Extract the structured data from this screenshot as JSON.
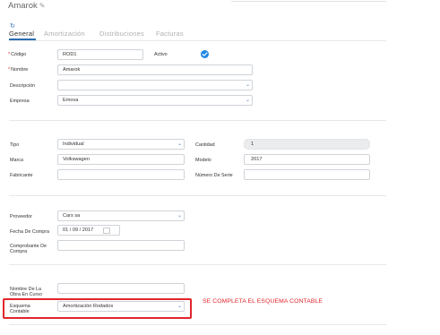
{
  "header": {
    "title": "Amarok"
  },
  "tabs": [
    {
      "label": "General",
      "active": true
    },
    {
      "label": "Amortización",
      "active": false
    },
    {
      "label": "Distribuciones",
      "active": false
    },
    {
      "label": "Facturas",
      "active": false
    }
  ],
  "fields": {
    "codigo": {
      "label": "Código",
      "value": "ROD1"
    },
    "activo": {
      "label": "Activo",
      "checked": true
    },
    "nombre": {
      "label": "Nombre",
      "value": "Amarok"
    },
    "descripcion": {
      "label": "Descripción",
      "value": ""
    },
    "empresa": {
      "label": "Empresa",
      "value": "Emova"
    },
    "tipo": {
      "label": "Tipo",
      "value": "Individual"
    },
    "cantidad": {
      "label": "Cantidad",
      "value": "1"
    },
    "marca": {
      "label": "Marca",
      "value": "Volkswagen"
    },
    "modelo": {
      "label": "Modelo",
      "value": "2017"
    },
    "fabricante": {
      "label": "Fabricante",
      "value": ""
    },
    "numero_serie": {
      "label": "Número De Serie",
      "value": ""
    },
    "proveedor": {
      "label": "Proveedor",
      "value": "Cars sa"
    },
    "fecha_compra": {
      "label": "Fecha De Compra",
      "value": "01 / 09 / 2017"
    },
    "comprobante": {
      "label_1": "Comprobante De",
      "label_2": "Compra",
      "value": ""
    },
    "nombre_obra": {
      "label_1": "Nombre De La",
      "label_2": "Obra En Curso",
      "value": ""
    },
    "esquema": {
      "label_1": "Esquema",
      "label_2": "Contable",
      "value": "Amortización Rodados"
    }
  },
  "annotation": {
    "text": "SE COMPLETA EL ESQUEMA CONTABLE",
    "color": "#e0262b"
  },
  "colors": {
    "accent": "#1e88e5",
    "required": "#e0262b"
  }
}
